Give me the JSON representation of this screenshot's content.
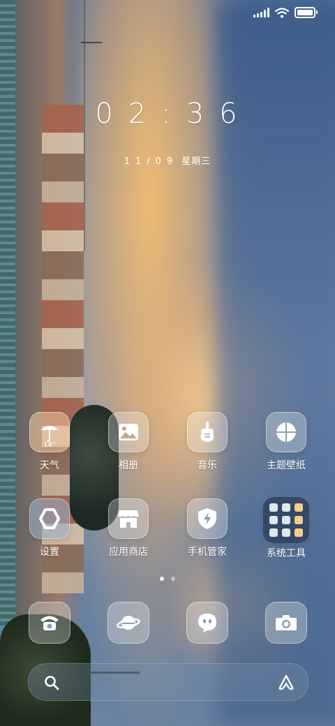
{
  "status_bar": {
    "signal": "signal-icon",
    "wifi": "wifi-icon",
    "battery": "battery-icon"
  },
  "clock": {
    "time": "02:36"
  },
  "date": {
    "md": "11/09",
    "weekday": "星期三"
  },
  "apps": [
    {
      "label": "天气",
      "icon": "umbrella-icon",
      "temp": "14°"
    },
    {
      "label": "相册",
      "icon": "gallery-icon"
    },
    {
      "label": "音乐",
      "icon": "guitar-icon"
    },
    {
      "label": "主题壁纸",
      "icon": "theme-icon"
    },
    {
      "label": "设置",
      "icon": "settings-icon"
    },
    {
      "label": "应用商店",
      "icon": "store-icon"
    },
    {
      "label": "手机管家",
      "icon": "security-icon"
    },
    {
      "label": "系统工具",
      "icon": "tools-folder-icon"
    }
  ],
  "pager": {
    "pages": 2,
    "current": 1
  },
  "dock": [
    {
      "icon": "phone-icon"
    },
    {
      "icon": "browser-icon"
    },
    {
      "icon": "messages-icon"
    },
    {
      "icon": "camera-icon"
    }
  ],
  "search": {
    "left_icon": "search-icon",
    "right_icon": "assistant-icon"
  }
}
